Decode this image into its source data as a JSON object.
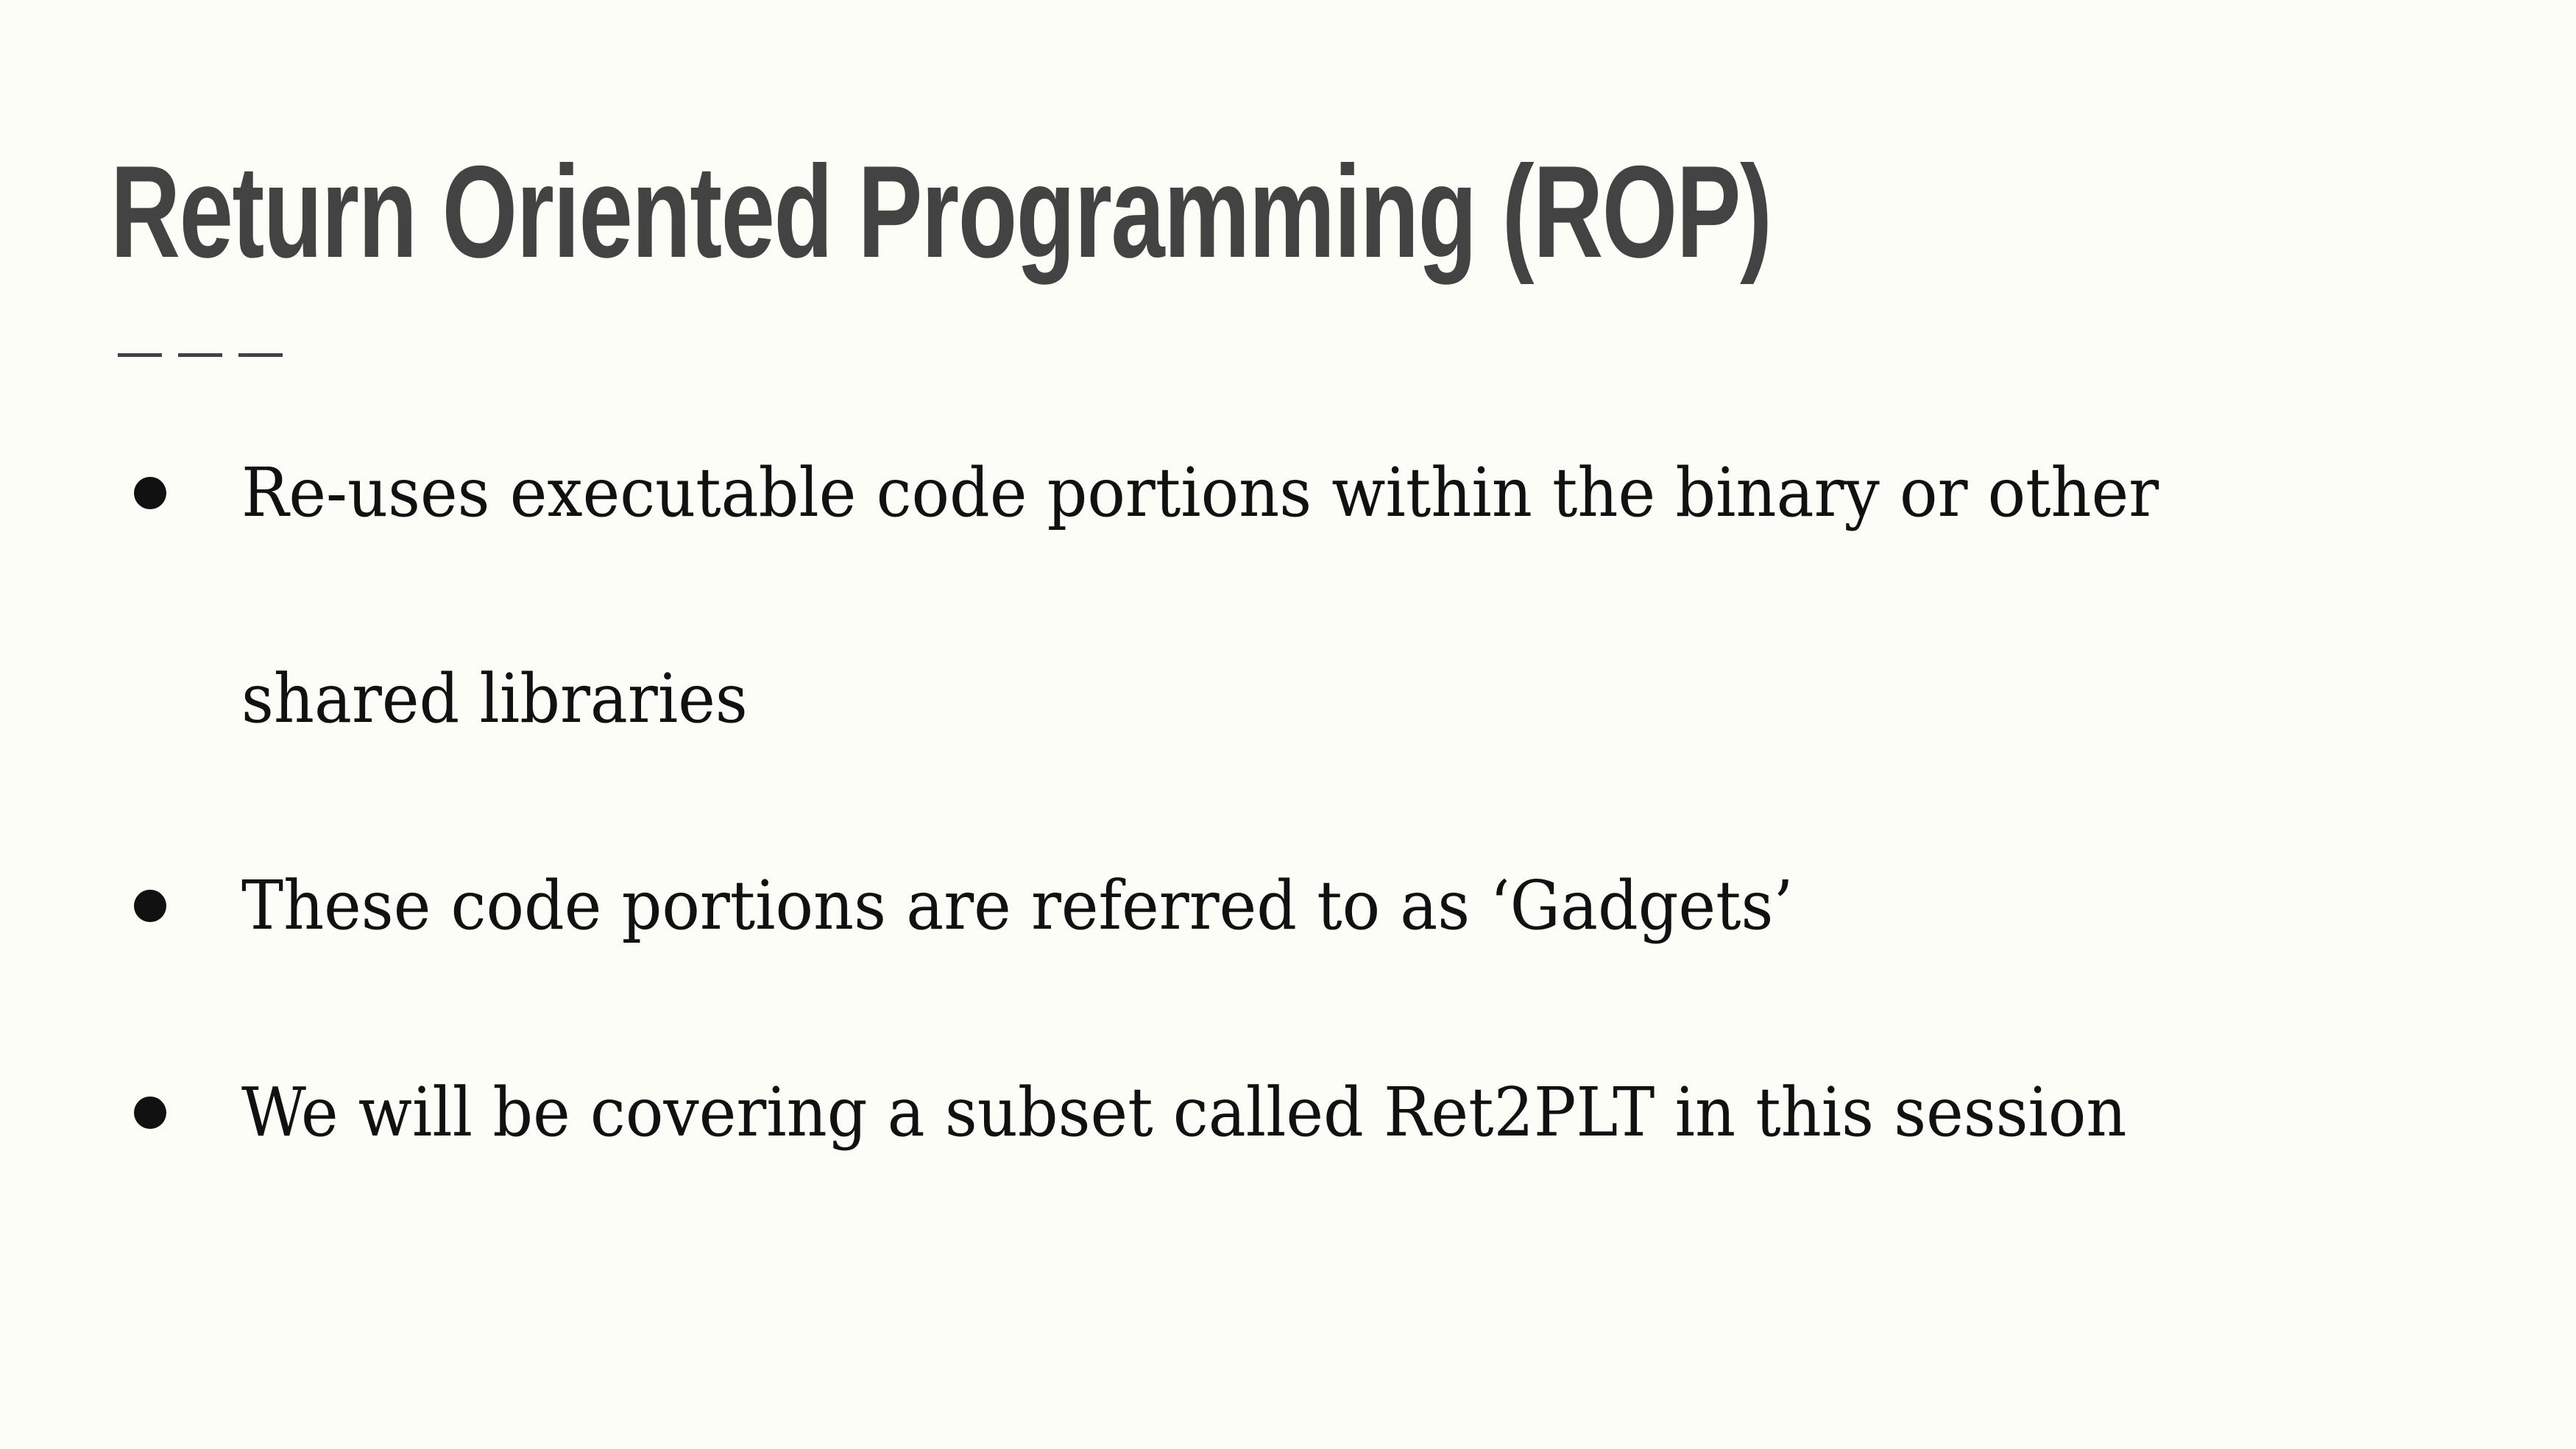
{
  "slide": {
    "title": "Return Oriented Programming (ROP)",
    "bullets": [
      {
        "line1": "Re-uses executable code portions within the binary or other",
        "line2": "shared libraries"
      },
      {
        "line1": "These code portions are referred to as ‘Gadgets’"
      },
      {
        "line1": "We will be covering a subset called Ret2PLT in this session"
      }
    ]
  }
}
